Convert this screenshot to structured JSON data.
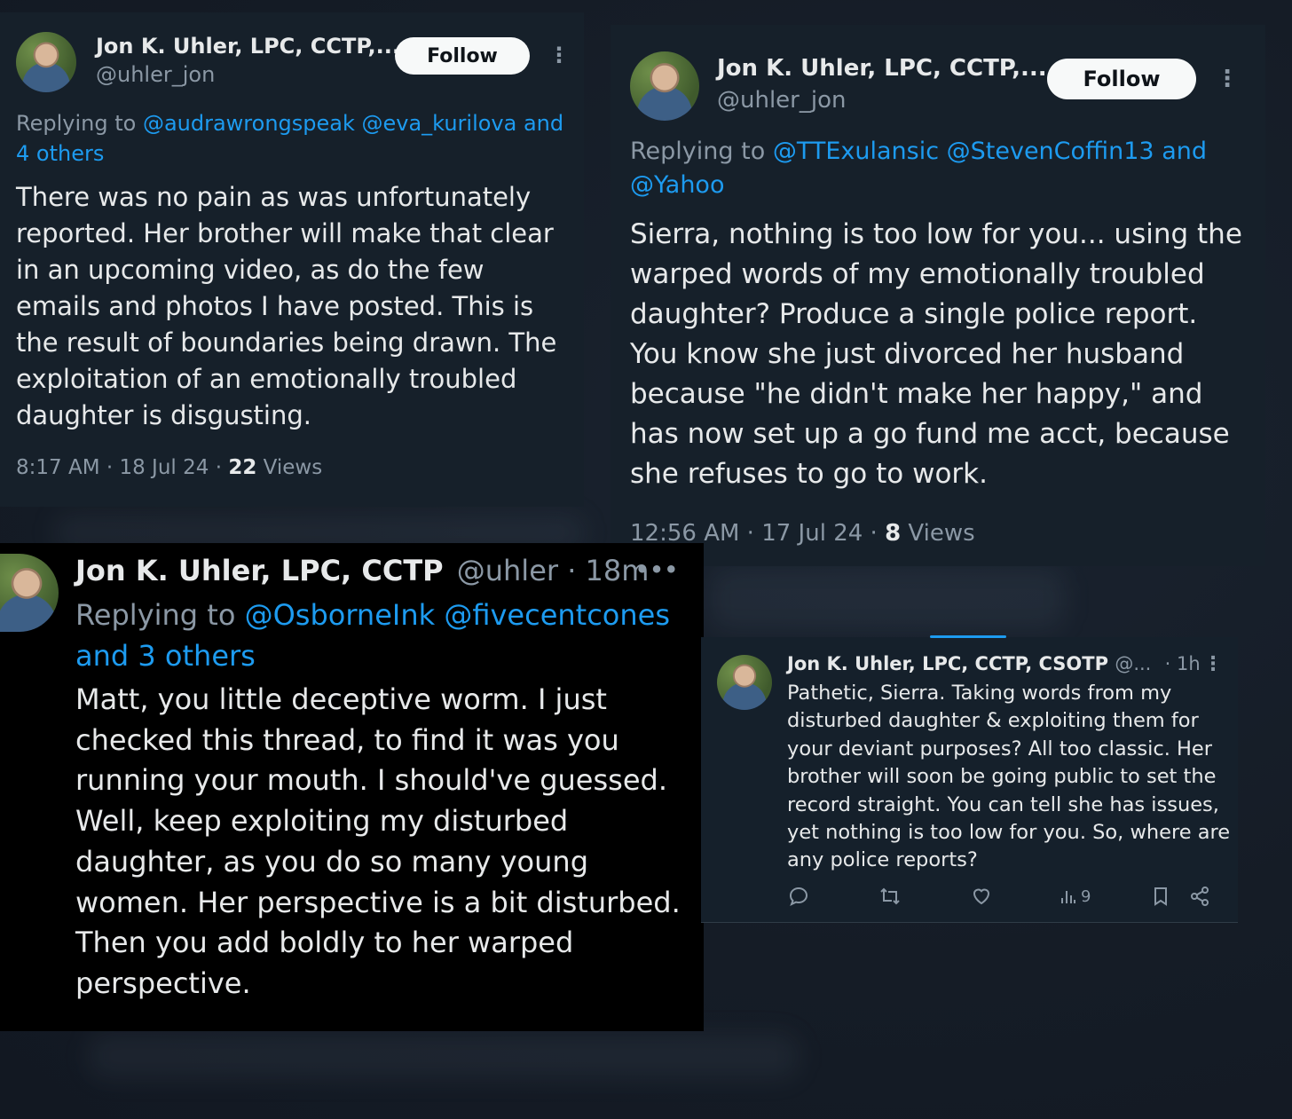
{
  "tweets": [
    {
      "name": "Jon K. Uhler, LPC, CCTP,...",
      "handle": "@uhler_jon",
      "follow_label": "Follow",
      "reply_prefix": "Replying to ",
      "reply_to": "@audrawrongspeak @eva_kurilova and 4 others",
      "body": "There was no pain as was unfortunately reported. Her brother will make that clear in an upcoming video, as do the few emails and photos I have posted. This is the result of boundaries being drawn. The exploitation of an emotionally troubled daughter is disgusting.",
      "meta_time": "8:17 AM · 18 Jul 24 · ",
      "views_count": "22",
      "views_label": " Views"
    },
    {
      "name": "Jon K. Uhler, LPC, CCTP,...",
      "handle": "@uhler_jon",
      "follow_label": "Follow",
      "reply_prefix": "Replying to ",
      "reply_to": "@TTExulansic @StevenCoffin13 and @Yahoo",
      "body": "Sierra, nothing is too low for you... using the warped words of my emotionally troubled daughter? Produce a single police report. You know she just divorced her husband because \"he didn't make her happy,\" and has now set up a go fund me acct, because she refuses to go to work.",
      "meta_time": "12:56 AM · 17 Jul 24 · ",
      "views_count": "8",
      "views_label": " Views"
    },
    {
      "name": "Jon K. Uhler, LPC, CCTP",
      "handle_time": "@uhler · 18m",
      "more": "•••",
      "reply_prefix": "Replying to ",
      "reply_to": "@OsborneInk @fivecentcones and 3 others",
      "body": "Matt, you little deceptive worm. I just checked this thread, to find it was you running your mouth. I should've guessed. Well, keep exploiting my disturbed daughter, as you do so many young women. Her perspective is a bit disturbed. Then you add boldly to her warped perspective."
    },
    {
      "name": "Jon K. Uhler, LPC, CCTP, CSOTP",
      "handle": "@...",
      "time": "· 1h",
      "body": "Pathetic, Sierra. Taking words from my disturbed daughter & exploiting them for your deviant purposes? All too classic. Her brother will soon be going public to set the record straight. You can tell she has issues, yet nothing is too low for you. So, where are any police reports?",
      "views": "9",
      "icons": [
        "reply-icon",
        "retweet-icon",
        "like-icon",
        "views-icon",
        "bookmark-icon",
        "share-icon"
      ]
    }
  ]
}
